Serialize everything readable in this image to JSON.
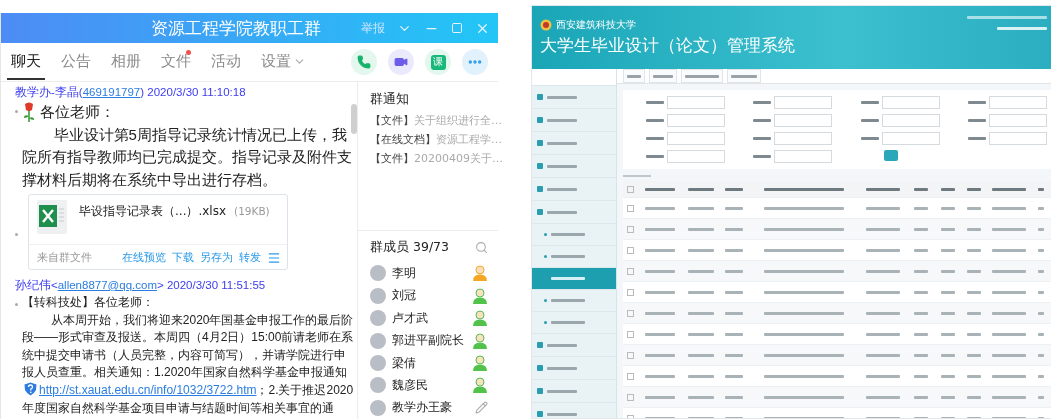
{
  "chat_window": {
    "title": "资源工程学院教职工群",
    "report_label": "举报",
    "tabs": [
      {
        "label": "聊天",
        "selected": true,
        "unread": false,
        "dropdown": false
      },
      {
        "label": "公告",
        "selected": false,
        "unread": false,
        "dropdown": false
      },
      {
        "label": "相册",
        "selected": false,
        "unread": false,
        "dropdown": false
      },
      {
        "label": "文件",
        "selected": false,
        "unread": true,
        "dropdown": false
      },
      {
        "label": "活动",
        "selected": false,
        "unread": false,
        "dropdown": false
      },
      {
        "label": "设置",
        "selected": false,
        "unread": false,
        "dropdown": true
      }
    ],
    "quick_actions": [
      {
        "kind": "call"
      },
      {
        "kind": "video"
      },
      {
        "kind": "class",
        "label": "课"
      },
      {
        "kind": "more"
      }
    ],
    "messages": [
      {
        "kind": "large",
        "sender": "教学办-李晶",
        "brackets": [
          "(",
          ")"
        ],
        "contact": "469191797",
        "time": "2020/3/30 11:10:18",
        "flower": true,
        "greeting": "各位老师：",
        "body": [
          {
            "kind": "text",
            "text": "毕业设计第5周指导记录统计情况已上传，我院所有指导教师均已完成提交。指导记录及附件支撑材料后期将在系统中导出进行存档。"
          }
        ],
        "attachment": {
          "name": "毕设指导记录表（...）.xlsx",
          "size": "(19KB)",
          "source": "来自群文件",
          "actions": [
            "在线预览",
            "下载",
            "另存为",
            "转发"
          ]
        }
      },
      {
        "kind": "normal",
        "sender": "孙纪伟",
        "brackets": [
          "<",
          ">"
        ],
        "contact": "allen8877@qq.com",
        "time": "2020/3/30 11:51:55",
        "flower": false,
        "greeting": "【转科技处】各位老师：",
        "body": [
          {
            "kind": "text",
            "text": "从本周开始，我们将迎来2020年国基金申报工作的最后阶段——形式审查及报送。本周四（4月2日）15:00前请老师在系统中提交申请书（人员完整，内容可简写），并请学院进行申报人员查重。相关通知：1.2020年国家自然科学基金申报通知"
          },
          {
            "kind": "icon"
          },
          {
            "kind": "link",
            "text": "http://st.xauat.edu.cn/info/1032/3722.htm"
          },
          {
            "kind": "text",
            "text": "；2.关于推迟2020年度国家自然科学基金项目申请与结题时间等相关事宜的通"
          }
        ]
      }
    ],
    "notices": {
      "heading": "群通知",
      "items": [
        {
          "tag": "【文件】",
          "text": "关于组织进行全…"
        },
        {
          "tag": "【在线文档】",
          "text": "资源工程学…"
        },
        {
          "tag": "【文件】",
          "text": "20200409关于…"
        }
      ]
    },
    "members": {
      "heading": "群成员 39/73",
      "items": [
        {
          "name": "李明",
          "kind": "owner"
        },
        {
          "name": "刘冠",
          "kind": "admin"
        },
        {
          "name": "卢才武",
          "kind": "admin"
        },
        {
          "name": "郭进平副院长",
          "kind": "admin"
        },
        {
          "name": "梁倩",
          "kind": "admin"
        },
        {
          "name": "魏彦民",
          "kind": "admin"
        },
        {
          "name": "教学办王豪",
          "kind": "editable"
        }
      ]
    }
  },
  "system_screen": {
    "school_name": "西安建筑科技大学",
    "system_title": "大学生毕业设计（论文）管理系统",
    "sidebar_items": [
      {
        "kind": "group",
        "selected": false
      },
      {
        "kind": "group",
        "selected": false
      },
      {
        "kind": "group",
        "selected": false
      },
      {
        "kind": "group",
        "selected": false
      },
      {
        "kind": "group",
        "selected": false
      },
      {
        "kind": "group",
        "selected": false
      },
      {
        "kind": "sub",
        "selected": false
      },
      {
        "kind": "sub",
        "selected": false
      },
      {
        "kind": "sub",
        "selected": true
      },
      {
        "kind": "sub",
        "selected": false
      },
      {
        "kind": "sub",
        "selected": false
      },
      {
        "kind": "group",
        "selected": false
      },
      {
        "kind": "group",
        "selected": false
      },
      {
        "kind": "group",
        "selected": false
      },
      {
        "kind": "group",
        "selected": false
      }
    ]
  }
}
